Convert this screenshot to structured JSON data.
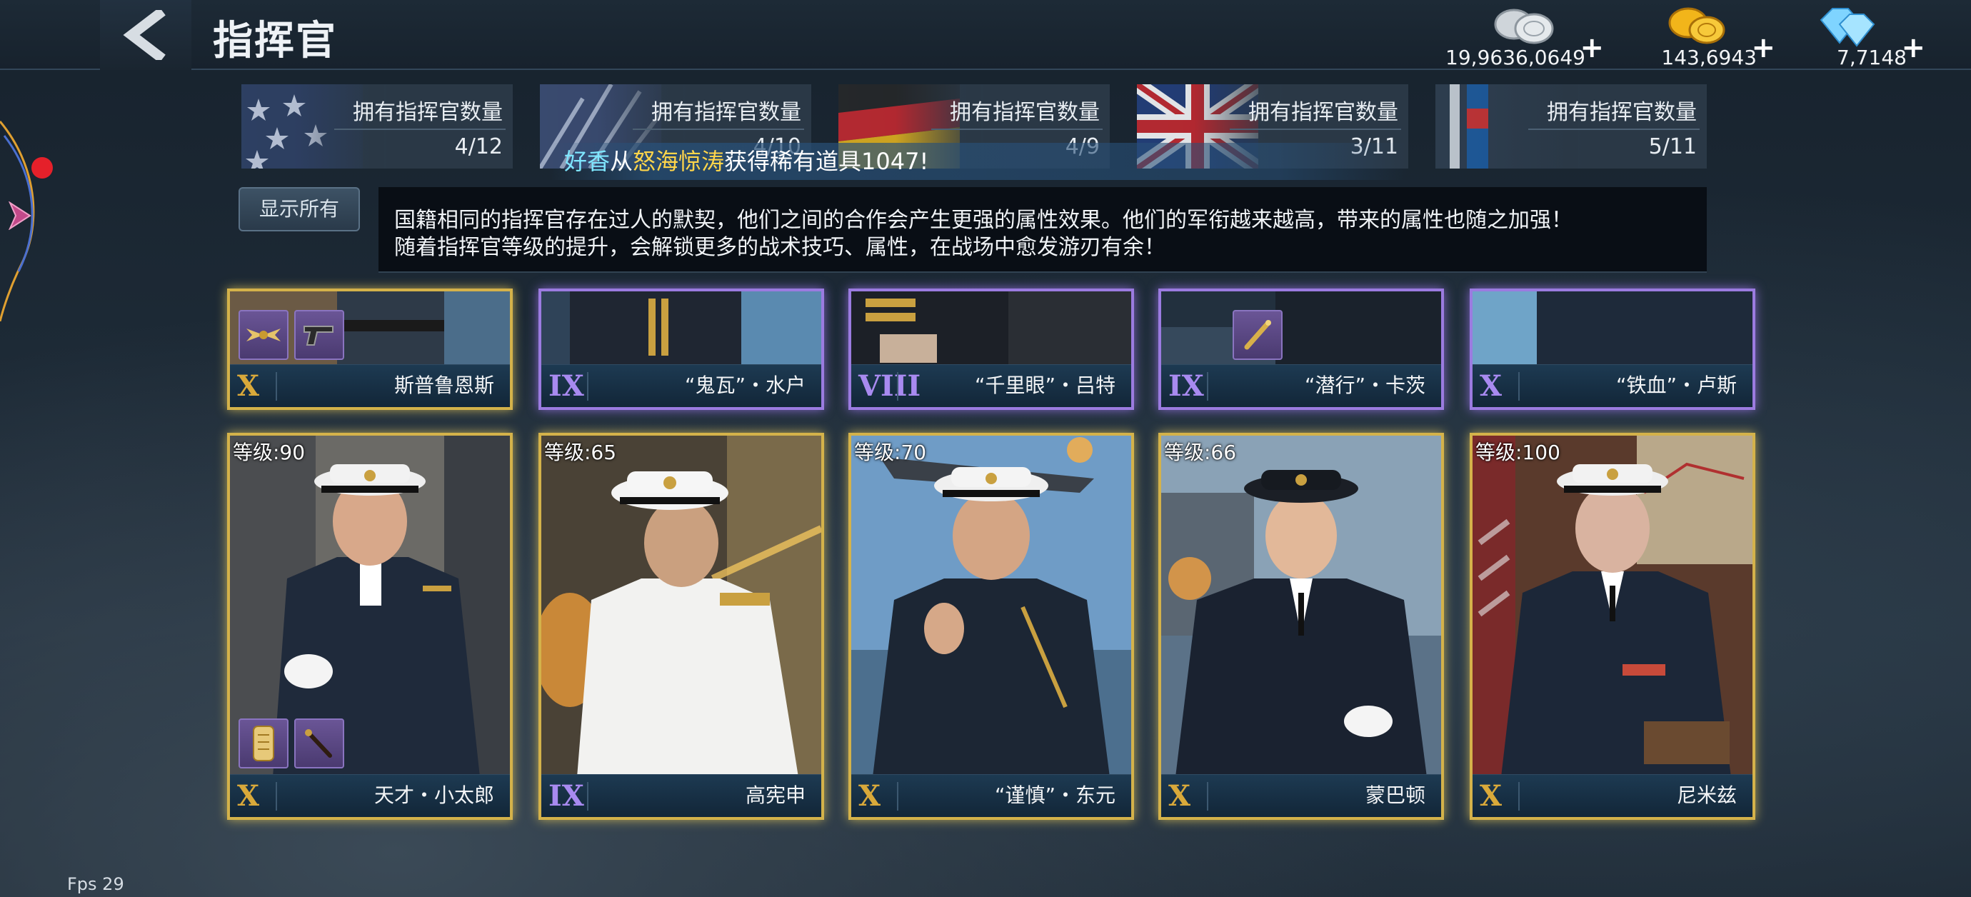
{
  "header": {
    "title": "指挥官"
  },
  "currencies": [
    {
      "icon": "silver-coins-icon",
      "value": "19,9636,0649",
      "plus": "+"
    },
    {
      "icon": "gold-coins-icon",
      "value": "143,6943",
      "plus": "+"
    },
    {
      "icon": "diamonds-icon",
      "value": "7,7148",
      "plus": "+"
    }
  ],
  "nation_tabs": [
    {
      "flag": "usa-flag",
      "label": "拥有指挥官数量",
      "count": "4/12"
    },
    {
      "flag": "japan-flag",
      "label": "拥有指挥官数量",
      "count": "4/10"
    },
    {
      "flag": "germany-flag",
      "label": "拥有指挥官数量",
      "count": "4/9"
    },
    {
      "flag": "uk-flag",
      "label": "拥有指挥官数量",
      "count": "3/11"
    },
    {
      "flag": "other-flag",
      "label": "拥有指挥官数量",
      "count": "5/11"
    }
  ],
  "notification": {
    "player": "好香",
    "prefix": "从",
    "source": "怒海惊涛",
    "text": "获得稀有道具1047!"
  },
  "show_all_label": "显示所有",
  "description": {
    "line1": "国籍相同的指挥官存在过人的默契，他们之间的合作会产生更强的属性效果。他们的军衔越来越高，带来的属性也随之加强！",
    "line2": "随着指挥官等级的提升，会解锁更多的战术技巧、属性，在战场中愈发游刃有余！"
  },
  "top_row": [
    {
      "rank": "X",
      "name": "斯普鲁恩斯",
      "quality": "gold",
      "items": [
        "wings-badge-icon",
        "pistol-icon"
      ]
    },
    {
      "rank": "IX",
      "name": "“鬼瓦”・水户",
      "quality": "purple",
      "items": []
    },
    {
      "rank": "VIII",
      "name": "“千里眼”・吕特",
      "quality": "purple",
      "items": []
    },
    {
      "rank": "IX",
      "name": "“潜行”・卡茨",
      "quality": "purple",
      "items": [
        "baton-icon"
      ]
    },
    {
      "rank": "X",
      "name": "“铁血”・卢斯",
      "quality": "purple",
      "items": []
    }
  ],
  "bottom_row": [
    {
      "level": "等级:90",
      "rank": "X",
      "name": "天才・小太郎",
      "quality": "gold",
      "uniform": "navy",
      "items": [
        "scroll-icon",
        "cane-icon"
      ]
    },
    {
      "level": "等级:65",
      "rank": "IX",
      "name": "高宪申",
      "quality": "gold",
      "uniform": "white",
      "items": []
    },
    {
      "level": "等级:70",
      "rank": "X",
      "name": "“谨慎”・东元",
      "quality": "gold",
      "uniform": "navy",
      "items": []
    },
    {
      "level": "等级:66",
      "rank": "X",
      "name": "蒙巴顿",
      "quality": "gold",
      "uniform": "navy",
      "items": []
    },
    {
      "level": "等级:100",
      "rank": "X",
      "name": "尼米兹",
      "quality": "gold",
      "uniform": "navy",
      "items": []
    }
  ],
  "fps": "Fps 29",
  "colors": {
    "gold_frame": "#d4b24a",
    "purple_frame": "#9b7be0",
    "alert_dot": "#e5202a"
  }
}
